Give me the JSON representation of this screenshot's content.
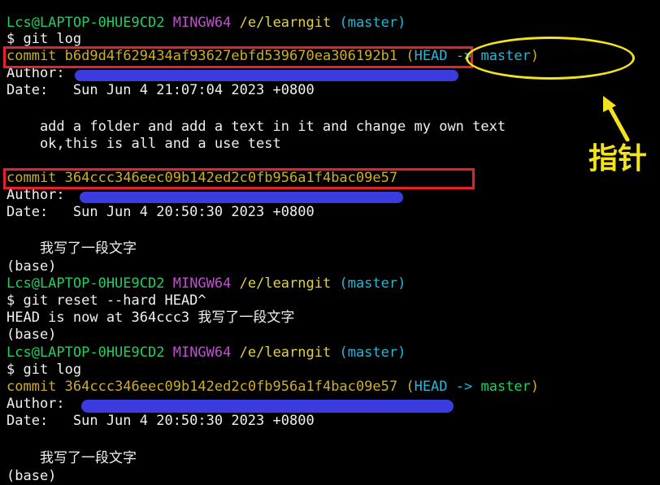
{
  "prompt1": {
    "user": "Lcs@LAPTOP-0HUE9CD2",
    "shell": "MINGW64",
    "path": "/e/learngit",
    "branch": "(master)"
  },
  "cmd1": "$ git log",
  "log1": {
    "commit1": {
      "label": "commit",
      "hash": "b6d9d4f629434af93627ebfd539670ea306192b1",
      "ref_open": "(",
      "ref": "HEAD -> master",
      "ref_close": ")"
    },
    "author1": "Author:",
    "date1": "Date:   Sun Jun 4 21:07:04 2023 +0800",
    "msg1a": "    add a folder and add a text in it and change my own text",
    "msg1b": "    ok,this is all and a use test",
    "commit2": {
      "label": "commit",
      "hash": "364ccc346eec09b142ed2c0fb956a1f4bac09e57"
    },
    "author2": "Author:",
    "date2": "Date:   Sun Jun 4 20:50:30 2023 +0800",
    "msg2": "    我写了一段文字"
  },
  "base1": "(base)",
  "prompt2": {
    "user": "Lcs@LAPTOP-0HUE9CD2",
    "shell": "MINGW64",
    "path": "/e/learngit",
    "branch": "(master)"
  },
  "cmd2": "$ git reset --hard HEAD^",
  "reset_out": "HEAD is now at 364ccc3 我写了一段文字",
  "base2": "(base)",
  "prompt3": {
    "user": "Lcs@LAPTOP-0HUE9CD2",
    "shell": "MINGW64",
    "path": "/e/learngit",
    "branch": "(master)"
  },
  "cmd3": "$ git log",
  "log2": {
    "commit": {
      "label": "commit",
      "hash": "364ccc346eec09b142ed2c0fb956a1f4bac09e57",
      "ref_open": "(",
      "head": "HEAD ->",
      "branch": "master",
      "ref_close": ")"
    },
    "author": "Author:",
    "date": "Date:   Sun Jun 4 20:50:30 2023 +0800",
    "msg": "    我写了一段文字"
  },
  "base3": "(base)",
  "annotation": {
    "label": "指针"
  }
}
